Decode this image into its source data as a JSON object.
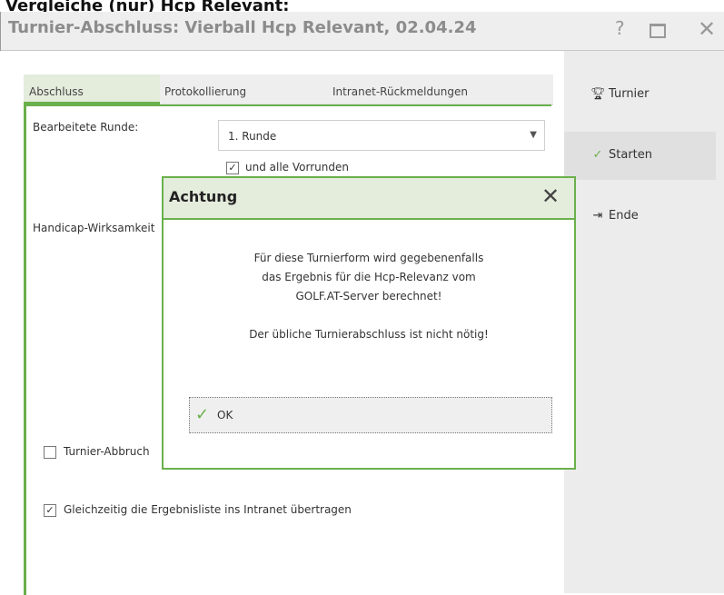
{
  "caption": "Vergleiche (nur) Hcp Relevant:",
  "window": {
    "title": "Turnier-Abschluss: Vierball Hcp Relevant, 02.04.24",
    "help": "?",
    "close": "✕"
  },
  "tabs": [
    {
      "label": "Abschluss",
      "active": true
    },
    {
      "label": "Protokollierung",
      "active": false
    },
    {
      "label": "Intranet-Rückmeldungen",
      "active": false
    }
  ],
  "form": {
    "round_label": "Bearbeitete Runde:",
    "round_value": "1. Runde",
    "round_arrow": "▼",
    "prev_rounds_label": "und alle Vorrunden",
    "prev_rounds_checked": true,
    "handicap_label": "Handicap-Wirksamkeit",
    "abort_label": "Turnier-Abbruch",
    "abort_checked": false,
    "upload_label": "Gleichzeitig die Ergebnisliste ins Intranet übertragen",
    "upload_checked": true
  },
  "side": {
    "tournament": "Turnier",
    "start": "Starten",
    "end": "Ende"
  },
  "dialog": {
    "title": "Achtung",
    "close": "✕",
    "line1": "Für diese Turnierform wird gegebenenfalls",
    "line2": "das Ergebnis für die Hcp-Relevanz vom",
    "line3": "GOLF.AT-Server berechnet!",
    "line4": "Der übliche Turnierabschluss ist nicht nötig!",
    "ok_label": "OK"
  },
  "colors": {
    "accent": "#6ab04c",
    "accent_light": "#e4ecdc"
  },
  "icons": [
    "trophy-icon",
    "check-icon",
    "exit-icon",
    "close-icon",
    "help-icon",
    "maximize-icon",
    "chevron-down-icon"
  ]
}
